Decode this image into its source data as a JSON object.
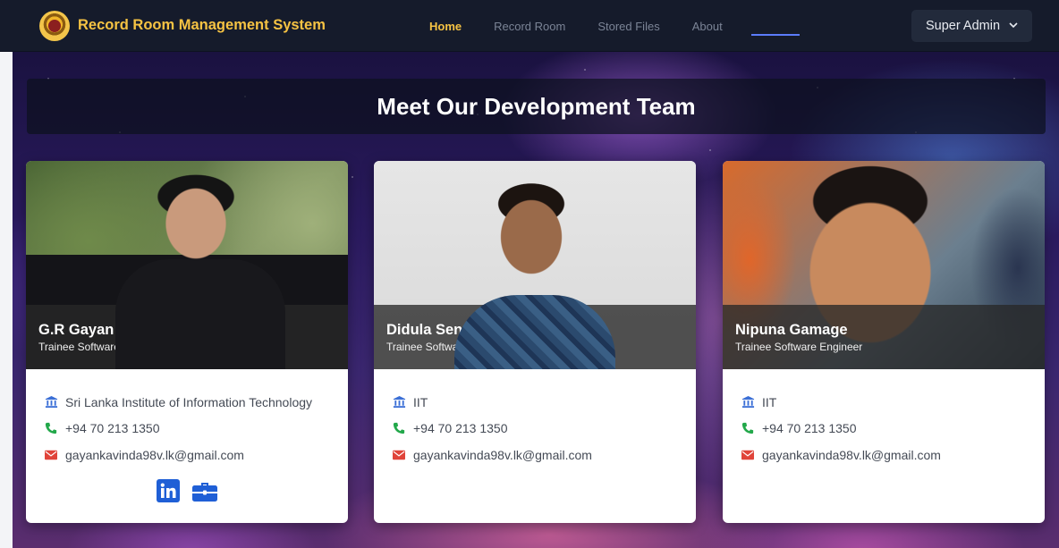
{
  "navbar": {
    "brand_title": "Record Room Management System",
    "links": [
      {
        "label": "Home",
        "active": true
      },
      {
        "label": "Record Room",
        "active": false
      },
      {
        "label": "Stored Files",
        "active": false
      },
      {
        "label": "About",
        "active": false
      }
    ],
    "user_menu_label": "Super Admin",
    "accent_color": "#f6c343"
  },
  "page": {
    "heading": "Meet Our Development Team"
  },
  "team": [
    {
      "name": "G.R Gayan Kavinda",
      "role": "Trainee Software Engineer (Fullstack Dev)",
      "institute": "Sri Lanka Institute of Information Technology",
      "phone": "+94 70 213 1350",
      "email": "gayankavinda98v.lk@gmail.com",
      "social": [
        "linkedin-icon",
        "briefcase-icon"
      ]
    },
    {
      "name": "Didula Senevirathna",
      "role": "Trainee Software Engineer",
      "institute": "IIT",
      "phone": "+94 70 213 1350",
      "email": "gayankavinda98v.lk@gmail.com"
    },
    {
      "name": "Nipuna Gamage",
      "role": "Trainee Software Engineer",
      "institute": "IIT",
      "phone": "+94 70 213 1350",
      "email": "gayankavinda98v.lk@gmail.com"
    }
  ],
  "icons": {
    "institute": "university-icon",
    "phone": "phone-icon",
    "email": "envelope-icon"
  },
  "colors": {
    "institute_icon": "#3b6fd6",
    "phone_icon": "#22a84a",
    "email_icon": "#e0443a",
    "social_icon": "#1f5fd6"
  }
}
